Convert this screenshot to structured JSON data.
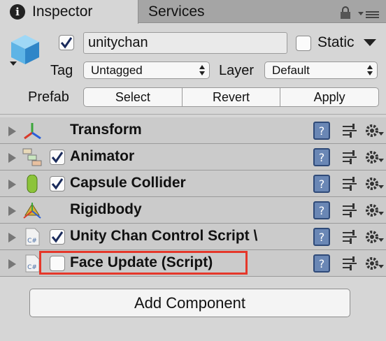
{
  "tabs": {
    "inspector_label": "Inspector",
    "services_label": "Services",
    "info_glyph": "i",
    "lock_icon": "lock-icon",
    "menu_icon": "panel-menu-icon"
  },
  "header": {
    "object_icon": "gameobject-cube-icon",
    "active_checked": true,
    "name_value": "unitychan",
    "static_label": "Static",
    "static_checked": false,
    "tag_label": "Tag",
    "tag_value": "Untagged",
    "layer_label": "Layer",
    "layer_value": "Default",
    "prefab_label": "Prefab",
    "prefab_buttons": [
      "Select",
      "Revert",
      "Apply"
    ]
  },
  "components": [
    {
      "name": "Transform",
      "icon": "transform-icon",
      "has_checkbox": false
    },
    {
      "name": "Animator",
      "icon": "animator-icon",
      "has_checkbox": true,
      "checked": true
    },
    {
      "name": "Capsule Collider",
      "icon": "capsule-collider-icon",
      "has_checkbox": true,
      "checked": true
    },
    {
      "name": "Rigidbody",
      "icon": "rigidbody-icon",
      "has_checkbox": false
    },
    {
      "name": "Unity Chan Control Script \\",
      "icon": "csharp-script-icon",
      "has_checkbox": true,
      "checked": true
    },
    {
      "name": "Face Update (Script)",
      "icon": "csharp-script-icon",
      "has_checkbox": true,
      "checked": false
    }
  ],
  "add_component_label": "Add Component",
  "colors": {
    "highlight": "#e5372a",
    "checkmark": "#1a2b5c",
    "help_icon": "#4a6fa5"
  }
}
